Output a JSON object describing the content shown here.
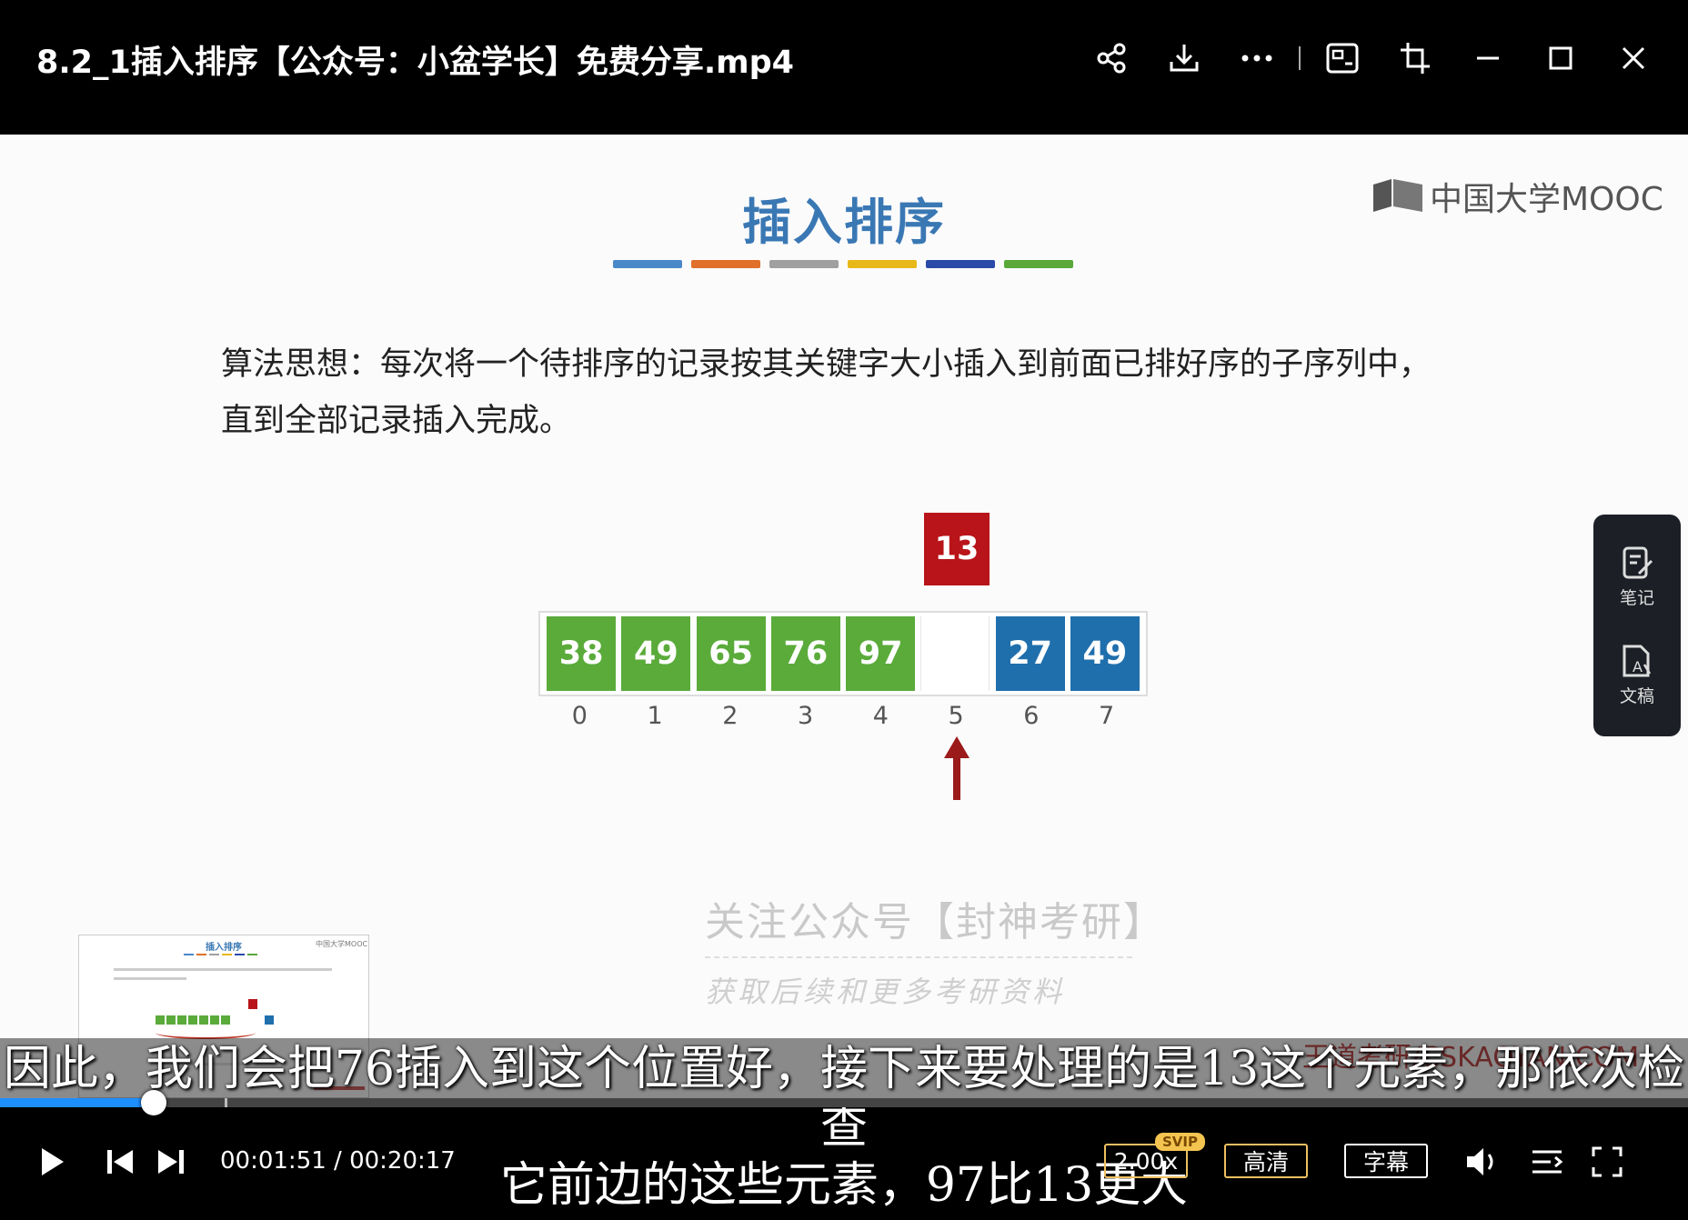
{
  "window": {
    "title": "8.2_1插入排序【公众号：小盆学长】免费分享.mp4",
    "icons": [
      "share-icon",
      "download-icon",
      "more-icon",
      "screenshot-icon",
      "crop-icon",
      "minimize-icon",
      "maximize-icon",
      "close-icon"
    ]
  },
  "slide": {
    "title": "插入排序",
    "bar_colors": [
      "#4a88c8",
      "#e0702a",
      "#a0a0a0",
      "#e8b818",
      "#2a4aa8",
      "#5aa83a"
    ],
    "logo_text": "中国大学MOOC",
    "idea_line1": "算法思想：每次将一个待排序的记录按其关键字大小插入到前面已排好序的子序列中，",
    "idea_line2": "直到全部记录插入完成。",
    "key_value": "13",
    "array": [
      {
        "value": "38",
        "state": "sorted"
      },
      {
        "value": "49",
        "state": "sorted"
      },
      {
        "value": "65",
        "state": "sorted"
      },
      {
        "value": "76",
        "state": "sorted"
      },
      {
        "value": "97",
        "state": "sorted"
      },
      {
        "value": "",
        "state": "empty"
      },
      {
        "value": "27",
        "state": "unsorted"
      },
      {
        "value": "49",
        "state": "unsorted"
      }
    ],
    "indices": [
      "0",
      "1",
      "2",
      "3",
      "4",
      "5",
      "6",
      "7"
    ],
    "arrow_index": 5,
    "watermark_line1": "关注公众号【封神考研】",
    "watermark_line2": "获取后续和更多考研资料",
    "watermark_site": "王道考研/CSKAOYAN.COM"
  },
  "side_panel": {
    "notes_label": "笔记",
    "doc_label": "文稿"
  },
  "subtitle": {
    "line1": "因此，我们会把76插入到这个位置好，接下来要处理的是13这个元素，那依次检查",
    "line2": "它前边的这些元素，97比13更大"
  },
  "player": {
    "current_time": "00:01:51",
    "separator": "/",
    "total_time": "00:20:17",
    "progress_fraction": 0.0912,
    "buffer_fraction": 0.133,
    "speed": "2.00x",
    "speed_badge": "SVIP",
    "quality": "高清",
    "subtitle_btn": "字幕",
    "colors": {
      "accent": "#1e8fff",
      "sorted": "#5aab3a",
      "unsorted": "#1f6fad",
      "key": "#b81419",
      "pill_border": "#f0c060"
    }
  }
}
